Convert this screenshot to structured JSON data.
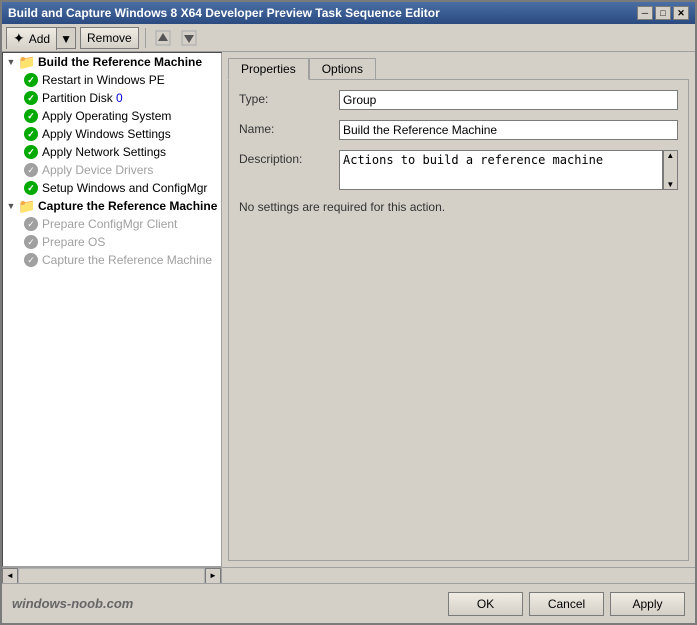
{
  "window": {
    "title": "Build and Capture Windows 8 X64 Developer Preview Task Sequence Editor"
  },
  "titlebar": {
    "minimize": "─",
    "maximize": "□",
    "close": "✕"
  },
  "toolbar": {
    "add_label": "Add",
    "remove_label": "Remove"
  },
  "tree": {
    "group1": {
      "label": "Build the Reference Machine",
      "items": [
        {
          "label": "Restart in Windows PE",
          "status": "check",
          "enabled": true
        },
        {
          "label": "Partition Disk 0",
          "status": "check",
          "enabled": true
        },
        {
          "label": "Apply Operating System",
          "status": "check",
          "enabled": true
        },
        {
          "label": "Apply Windows Settings",
          "status": "check",
          "enabled": true
        },
        {
          "label": "Apply Network Settings",
          "status": "check",
          "enabled": true
        },
        {
          "label": "Apply Device Drivers",
          "status": "gray",
          "enabled": false
        },
        {
          "label": "Setup Windows and ConfigMgr",
          "status": "check",
          "enabled": true
        }
      ]
    },
    "group2": {
      "label": "Capture the Reference Machine",
      "items": [
        {
          "label": "Prepare ConfigMgr Client",
          "status": "gray",
          "enabled": false
        },
        {
          "label": "Prepare OS",
          "status": "gray",
          "enabled": false
        },
        {
          "label": "Capture the Reference Machine",
          "status": "gray",
          "enabled": false
        }
      ]
    }
  },
  "tabs": {
    "properties": "Properties",
    "options": "Options"
  },
  "form": {
    "type_label": "Type:",
    "type_value": "Group",
    "name_label": "Name:",
    "name_value": "Build the Reference Machine",
    "description_label": "Description:",
    "description_value": "Actions to build a reference machine",
    "no_settings_text": "No settings are required for this action."
  },
  "footer": {
    "watermark": "windows-noob.com",
    "ok_label": "OK",
    "cancel_label": "Cancel",
    "apply_label": "Apply"
  }
}
